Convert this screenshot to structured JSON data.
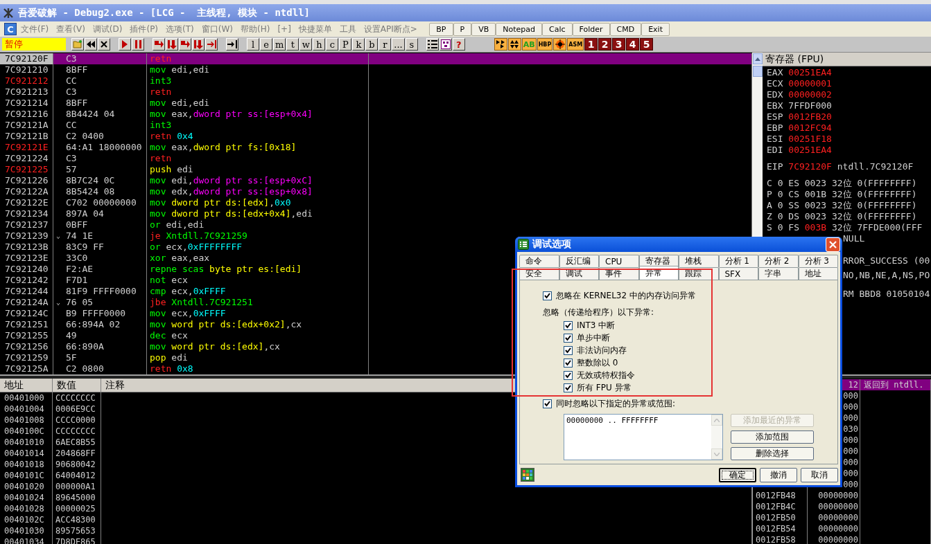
{
  "window": {
    "title": "吾爱破解 - Debug2.exe - [LCG -  主线程, 模块 - ntdll]"
  },
  "menu": {
    "logo": "C",
    "items": [
      "文件(F)",
      "查看(V)",
      "调试(D)",
      "插件(P)",
      "选项(T)",
      "窗口(W)",
      "帮助(H)",
      "[+]",
      "快捷菜单",
      "工具",
      "设置API断点>"
    ],
    "buttons": [
      "BP",
      "P",
      "VB",
      "Notepad",
      "Calc",
      "Folder",
      "CMD",
      "Exit"
    ]
  },
  "toolbar": {
    "status": "暂停",
    "letters": [
      "l",
      "e",
      "m",
      "t",
      "w",
      "h",
      "c",
      "P",
      "k",
      "b",
      "r",
      "...",
      "s"
    ],
    "help": "?",
    "plugins": [
      "AB",
      "HBP",
      "ASM"
    ],
    "numbers": [
      "1",
      "2",
      "3",
      "4",
      "5"
    ]
  },
  "disassembly": {
    "rows": [
      {
        "address": "7C92120F",
        "bp": false,
        "selected": true,
        "hex": "C3",
        "asm": [
          {
            "text": "retn",
            "kind": "ret"
          }
        ]
      },
      {
        "address": "7C921210",
        "bp": false,
        "selected": false,
        "hex": "8BFF",
        "asm": [
          {
            "text": "mov",
            "kind": "op"
          },
          {
            "text": " edi,edi",
            "kind": "reg"
          }
        ]
      },
      {
        "address": "7C921212",
        "bp": true,
        "selected": false,
        "hex": "CC",
        "asm": [
          {
            "text": "int3",
            "kind": "op"
          }
        ]
      },
      {
        "address": "7C921213",
        "bp": false,
        "selected": false,
        "hex": "C3",
        "asm": [
          {
            "text": "retn",
            "kind": "ret"
          }
        ]
      },
      {
        "address": "7C921214",
        "bp": false,
        "selected": false,
        "hex": "8BFF",
        "asm": [
          {
            "text": "mov",
            "kind": "op"
          },
          {
            "text": " edi,edi",
            "kind": "reg"
          }
        ]
      },
      {
        "address": "7C921216",
        "bp": false,
        "selected": false,
        "hex": "8B4424 04",
        "asm": [
          {
            "text": "mov",
            "kind": "op"
          },
          {
            "text": " eax,",
            "kind": "reg"
          },
          {
            "text": "dword ptr ss:[esp+0x4]",
            "kind": "sm"
          }
        ]
      },
      {
        "address": "7C92121A",
        "bp": false,
        "selected": false,
        "hex": "CC",
        "asm": [
          {
            "text": "int3",
            "kind": "op"
          }
        ]
      },
      {
        "address": "7C92121B",
        "bp": false,
        "selected": false,
        "hex": "C2 0400",
        "asm": [
          {
            "text": "retn",
            "kind": "ret"
          },
          {
            "text": " 0x4",
            "kind": "num"
          }
        ]
      },
      {
        "address": "7C92121E",
        "bp": true,
        "selected": false,
        "hex": "64:A1 18000000",
        "asm": [
          {
            "text": "mov",
            "kind": "op"
          },
          {
            "text": " eax,",
            "kind": "reg"
          },
          {
            "text": "dword ptr fs:[0x18]",
            "kind": "mem"
          }
        ]
      },
      {
        "address": "7C921224",
        "bp": false,
        "selected": false,
        "hex": "C3",
        "asm": [
          {
            "text": "retn",
            "kind": "ret"
          }
        ]
      },
      {
        "address": "7C921225",
        "bp": true,
        "selected": false,
        "hex": "57",
        "asm": [
          {
            "text": "push",
            "kind": "stk"
          },
          {
            "text": " edi",
            "kind": "reg"
          }
        ]
      },
      {
        "address": "7C921226",
        "bp": false,
        "selected": false,
        "hex": "8B7C24 0C",
        "asm": [
          {
            "text": "mov",
            "kind": "op"
          },
          {
            "text": " edi,",
            "kind": "reg"
          },
          {
            "text": "dword ptr ss:[esp+0xC]",
            "kind": "sm"
          }
        ]
      },
      {
        "address": "7C92122A",
        "bp": false,
        "selected": false,
        "hex": "8B5424 08",
        "asm": [
          {
            "text": "mov",
            "kind": "op"
          },
          {
            "text": " edx,",
            "kind": "reg"
          },
          {
            "text": "dword ptr ss:[esp+0x8]",
            "kind": "sm"
          }
        ]
      },
      {
        "address": "7C92122E",
        "bp": false,
        "selected": false,
        "hex": "C702 00000000",
        "asm": [
          {
            "text": "mov",
            "kind": "op"
          },
          {
            "text": " dword ptr ds:[edx]",
            "kind": "mem"
          },
          {
            "text": ",",
            "kind": "reg"
          },
          {
            "text": "0x0",
            "kind": "num"
          }
        ]
      },
      {
        "address": "7C921234",
        "bp": false,
        "selected": false,
        "hex": "897A 04",
        "asm": [
          {
            "text": "mov",
            "kind": "op"
          },
          {
            "text": " dword ptr ds:[edx+0x4]",
            "kind": "mem"
          },
          {
            "text": ",edi",
            "kind": "reg"
          }
        ]
      },
      {
        "address": "7C921237",
        "bp": false,
        "selected": false,
        "hex": "0BFF",
        "asm": [
          {
            "text": "or",
            "kind": "op"
          },
          {
            "text": " edi,edi",
            "kind": "reg"
          }
        ]
      },
      {
        "address": "7C921239",
        "bp": false,
        "selected": false,
        "arrow": "⌄",
        "hex": "74 1E",
        "asm": [
          {
            "text": "je",
            "kind": "jmp"
          },
          {
            "text": " Xntdll.7C921259",
            "kind": "dst"
          }
        ]
      },
      {
        "address": "7C92123B",
        "bp": false,
        "selected": false,
        "hex": "83C9 FF",
        "asm": [
          {
            "text": "or",
            "kind": "op"
          },
          {
            "text": " ecx,",
            "kind": "reg"
          },
          {
            "text": "0xFFFFFFFF",
            "kind": "num"
          }
        ]
      },
      {
        "address": "7C92123E",
        "bp": false,
        "selected": false,
        "hex": "33C0",
        "asm": [
          {
            "text": "xor",
            "kind": "op"
          },
          {
            "text": " eax,eax",
            "kind": "reg"
          }
        ]
      },
      {
        "address": "7C921240",
        "bp": false,
        "selected": false,
        "hex": "F2:AE",
        "asm": [
          {
            "text": "repne scas",
            "kind": "op"
          },
          {
            "text": " byte ptr es:[edi]",
            "kind": "mem"
          }
        ]
      },
      {
        "address": "7C921242",
        "bp": false,
        "selected": false,
        "hex": "F7D1",
        "asm": [
          {
            "text": "not",
            "kind": "op"
          },
          {
            "text": " ecx",
            "kind": "reg"
          }
        ]
      },
      {
        "address": "7C921244",
        "bp": false,
        "selected": false,
        "hex": "81F9 FFFF0000",
        "asm": [
          {
            "text": "cmp",
            "kind": "op"
          },
          {
            "text": " ecx,",
            "kind": "reg"
          },
          {
            "text": "0xFFFF",
            "kind": "num"
          }
        ]
      },
      {
        "address": "7C92124A",
        "bp": false,
        "selected": false,
        "arrow": "⌄",
        "hex": "76 05",
        "asm": [
          {
            "text": "jbe",
            "kind": "jmp"
          },
          {
            "text": " Xntdll.7C921251",
            "kind": "dst"
          }
        ]
      },
      {
        "address": "7C92124C",
        "bp": false,
        "selected": false,
        "hex": "B9 FFFF0000",
        "asm": [
          {
            "text": "mov",
            "kind": "op"
          },
          {
            "text": " ecx,",
            "kind": "reg"
          },
          {
            "text": "0xFFFF",
            "kind": "num"
          }
        ]
      },
      {
        "address": "7C921251",
        "bp": false,
        "selected": false,
        "hex": "66:894A 02",
        "asm": [
          {
            "text": "mov",
            "kind": "op"
          },
          {
            "text": " word ptr ds:[edx+0x2]",
            "kind": "mem"
          },
          {
            "text": ",cx",
            "kind": "reg"
          }
        ]
      },
      {
        "address": "7C921255",
        "bp": false,
        "selected": false,
        "hex": "49",
        "asm": [
          {
            "text": "dec",
            "kind": "op"
          },
          {
            "text": " ecx",
            "kind": "reg"
          }
        ]
      },
      {
        "address": "7C921256",
        "bp": false,
        "selected": false,
        "hex": "66:890A",
        "asm": [
          {
            "text": "mov",
            "kind": "op"
          },
          {
            "text": " word ptr ds:[edx]",
            "kind": "mem"
          },
          {
            "text": ",cx",
            "kind": "reg"
          }
        ]
      },
      {
        "address": "7C921259",
        "bp": false,
        "selected": false,
        "hex": "5F",
        "asm": [
          {
            "text": "pop",
            "kind": "stk"
          },
          {
            "text": " edi",
            "kind": "reg"
          }
        ]
      },
      {
        "address": "7C92125A",
        "bp": false,
        "selected": false,
        "hex": "C2 0800",
        "asm": [
          {
            "text": "retn",
            "kind": "ret"
          },
          {
            "text": " 0x8",
            "kind": "num"
          }
        ]
      }
    ]
  },
  "registers": {
    "title": "寄存器 (FPU)",
    "general": [
      {
        "name": "EAX",
        "value": "00251EA4",
        "changed": true
      },
      {
        "name": "ECX",
        "value": "00000001",
        "changed": true
      },
      {
        "name": "EDX",
        "value": "00000002",
        "changed": true
      },
      {
        "name": "EBX",
        "value": "7FFDF000",
        "changed": false
      },
      {
        "name": "ESP",
        "value": "0012FB20",
        "changed": true
      },
      {
        "name": "EBP",
        "value": "0012FC94",
        "changed": true
      },
      {
        "name": "ESI",
        "value": "00251F18",
        "changed": true
      },
      {
        "name": "EDI",
        "value": "00251EA4",
        "changed": true
      }
    ],
    "eip": {
      "name": "EIP",
      "value": "7C92120F",
      "changed": true,
      "comment": "ntdll.7C92120F"
    },
    "flags": [
      {
        "flag": "C",
        "flag_value": "0",
        "segment": "ES",
        "selector": "0023",
        "changed": false,
        "bits": "32位",
        "base": "0(FFFFFFFF)"
      },
      {
        "flag": "P",
        "flag_value": "0",
        "segment": "CS",
        "selector": "001B",
        "changed": false,
        "bits": "32位",
        "base": "0(FFFFFFFF)"
      },
      {
        "flag": "A",
        "flag_value": "0",
        "segment": "SS",
        "selector": "0023",
        "changed": false,
        "bits": "32位",
        "base": "0(FFFFFFFF)"
      },
      {
        "flag": "Z",
        "flag_value": "0",
        "segment": "DS",
        "selector": "0023",
        "changed": false,
        "bits": "32位",
        "base": "0(FFFFFFFF)"
      },
      {
        "flag": "S",
        "flag_value": "0",
        "segment": "FS",
        "selector": "003B",
        "changed": true,
        "bits": "32位",
        "base": "7FFDE000(FFF"
      }
    ],
    "fragments": [
      "NULL",
      "RROR_SUCCESS (00",
      "NO,NB,NE,A,NS,PO",
      "RM BBD8 01050104"
    ]
  },
  "dump": {
    "columns": [
      "地址",
      "数值",
      "注释"
    ],
    "rows": [
      {
        "address": "00401000",
        "value": "CCCCCCCC"
      },
      {
        "address": "00401004",
        "value": "0006E9CC"
      },
      {
        "address": "00401008",
        "value": "CCCC0000"
      },
      {
        "address": "0040100C",
        "value": "CCCCCCCC"
      },
      {
        "address": "00401010",
        "value": "6AEC8B55"
      },
      {
        "address": "00401014",
        "value": "204868FF"
      },
      {
        "address": "00401018",
        "value": "90680042"
      },
      {
        "address": "0040101C",
        "value": "64004012"
      },
      {
        "address": "00401020",
        "value": "000000A1"
      },
      {
        "address": "00401024",
        "value": "89645000"
      },
      {
        "address": "00401028",
        "value": "00000025"
      },
      {
        "address": "0040102C",
        "value": "ACC48300"
      },
      {
        "address": "00401030",
        "value": "89575653"
      },
      {
        "address": "00401034",
        "value": "7D8DE865"
      }
    ]
  },
  "stack": {
    "rows": [
      {
        "value": "12",
        "comment": "返回到 ntdll.",
        "selected": true
      },
      {
        "value": "000",
        "selected": false
      },
      {
        "value": "000",
        "selected": false
      },
      {
        "value": "000",
        "selected": false
      },
      {
        "value": "030",
        "selected": false
      },
      {
        "value": "000",
        "selected": false
      },
      {
        "value": "000",
        "selected": false
      },
      {
        "value": "000",
        "selected": false
      },
      {
        "value": "000",
        "selected": false
      },
      {
        "value": "000",
        "selected": false
      },
      {
        "address": "0012FB48",
        "value": "00000000",
        "selected": false
      },
      {
        "address": "0012FB4C",
        "value": "00000000",
        "selected": false
      },
      {
        "address": "0012FB50",
        "value": "00000000",
        "selected": false
      },
      {
        "address": "0012FB54",
        "value": "00000000",
        "selected": false
      },
      {
        "address": "0012FB58",
        "value": "00000000",
        "selected": false
      }
    ]
  },
  "dialog": {
    "title": "调试选项",
    "tab_rows": [
      [
        {
          "label": "命令",
          "selected": false
        },
        {
          "label": "反汇编",
          "selected": false
        },
        {
          "label": "CPU",
          "selected": false
        },
        {
          "label": "寄存器",
          "selected": false
        },
        {
          "label": "堆栈",
          "selected": false
        },
        {
          "label": "分析 1",
          "selected": false
        },
        {
          "label": "分析 2",
          "selected": false
        },
        {
          "label": "分析 3",
          "selected": false
        }
      ],
      [
        {
          "label": "安全",
          "selected": false
        },
        {
          "label": "调试",
          "selected": false
        },
        {
          "label": "事件",
          "selected": false
        },
        {
          "label": "异常",
          "selected": true
        },
        {
          "label": "跟踪",
          "selected": false
        },
        {
          "label": "SFX",
          "selected": false
        },
        {
          "label": "字串",
          "selected": false
        },
        {
          "label": "地址",
          "selected": false
        }
      ]
    ],
    "ignore_kernel32": {
      "label": "忽略在 KERNEL32 中的内存访问异常",
      "checked": true
    },
    "pass_label": "忽略（传递给程序）以下异常:",
    "exceptions": [
      {
        "label": "INT3 中断",
        "checked": true
      },
      {
        "label": "单步中断",
        "checked": true
      },
      {
        "label": "非法访问内存",
        "checked": true
      },
      {
        "label": "整数除以 0",
        "checked": true
      },
      {
        "label": "无效或特权指令",
        "checked": true
      },
      {
        "label": "所有 FPU 异常",
        "checked": true
      }
    ],
    "ignore_ranges": {
      "label": "同时忽略以下指定的异常或范围:",
      "checked": true
    },
    "ranges": [
      "00000000 .. FFFFFFFF"
    ],
    "side_buttons": [
      {
        "label": "添加最近的异常",
        "disabled": true
      },
      {
        "label": "添加范围",
        "disabled": false
      },
      {
        "label": "删除选择",
        "disabled": false
      }
    ],
    "buttons": [
      {
        "label": "确定",
        "default": true
      },
      {
        "label": "撤消",
        "default": false
      },
      {
        "label": "取消",
        "default": false
      }
    ]
  }
}
